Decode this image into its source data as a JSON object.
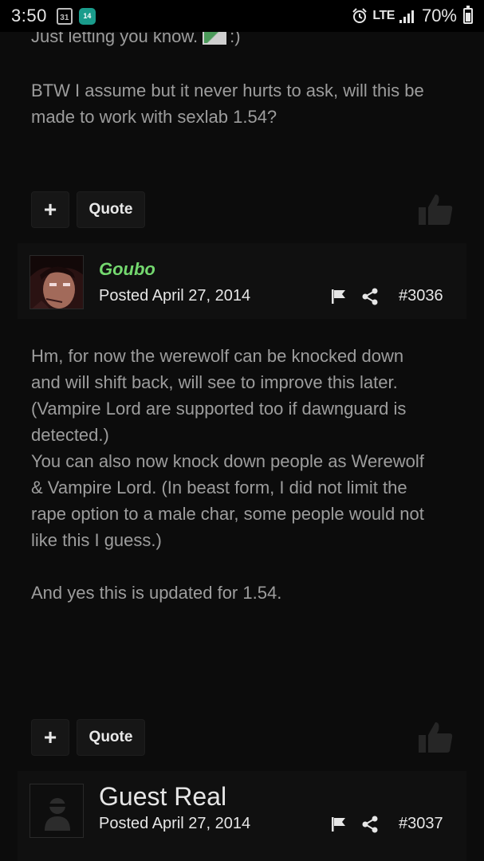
{
  "status_bar": {
    "time": "3:50",
    "calendar_day": "31",
    "app_badge": "14",
    "network": "LTE",
    "battery": "70%",
    "battery_level": 0.7
  },
  "prev_post": {
    "cut_line": "Just letting you know.",
    "cut_line_suffix": ":)",
    "paragraph_lines": [
      "BTW I assume but it never hurts to ask, will this be",
      "made to work with sexlab 1.54?"
    ]
  },
  "actions": {
    "plus_label": "+",
    "quote_label": "Quote"
  },
  "post_3036": {
    "author": "Goubo",
    "posted": "Posted April 27, 2014",
    "number": "#3036",
    "lines": [
      "Hm, for now the werewolf can be knocked down",
      "and will shift back, will see to improve this later.",
      "(Vampire Lord are supported too if dawnguard is",
      "detected.)",
      "You can also now knock down people as Werewolf",
      "& Vampire Lord. (In beast form, I did not limit the",
      "rape option to a male char, some people would not",
      "like this I guess.)",
      "",
      "And yes this is updated for 1.54."
    ]
  },
  "post_3037": {
    "author": "Guest Real",
    "posted": "Posted April 27, 2014",
    "number": "#3037"
  },
  "colors": {
    "background": "#0c0c0c",
    "author_member": "#74d86f",
    "body_text": "#9d9d9d",
    "button_bg": "#161616"
  }
}
